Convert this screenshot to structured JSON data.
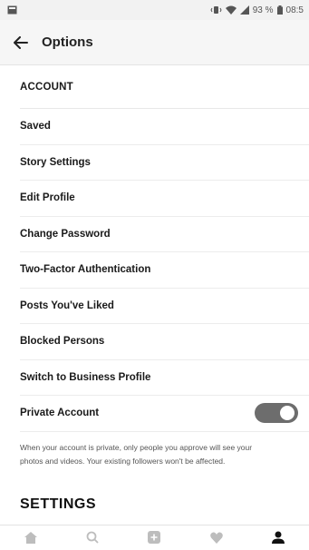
{
  "status_bar": {
    "battery_percent": "93 %",
    "time": "08:5"
  },
  "header": {
    "title": "Options"
  },
  "list": {
    "section_account": "ACCOUNT",
    "items": [
      "Saved",
      "Story Settings",
      "Edit Profile",
      "Change Password",
      "Two-Factor Authentication",
      "Posts You've Liked",
      "Blocked Persons",
      "Switch to Business Profile"
    ],
    "private_account": {
      "label": "Private Account",
      "enabled": true
    },
    "private_help": "When your account is private, only people you approve will see your photos and videos. Your existing followers won't be affected.",
    "section_settings": "SETTINGS"
  },
  "bottom_nav": {
    "icons": [
      "home-icon",
      "search-icon",
      "add-post-icon",
      "heart-icon",
      "profile-icon"
    ]
  },
  "colors": {
    "toggle_on": "#6d6d6d",
    "status_bar_bg": "#f2f2f2",
    "app_bar_bg": "#f6f6f6"
  }
}
